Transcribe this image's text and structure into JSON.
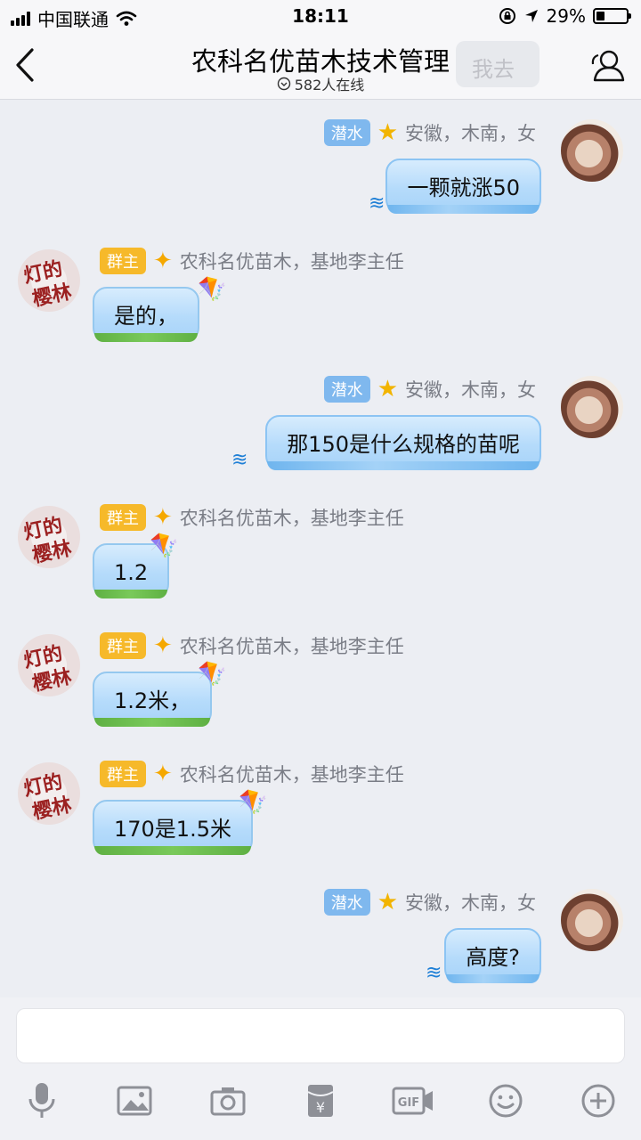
{
  "status": {
    "carrier": "中国联通",
    "time": "18:11",
    "battery": "29%",
    "battery_level": 0.29
  },
  "header": {
    "title": "农科名优苗木技术管理",
    "online": "582人在线",
    "ghost_text": "我去"
  },
  "messages": [
    {
      "side": "right",
      "badge": "潜水",
      "meta": "安徽，木南，女",
      "text": "一颗就涨50"
    },
    {
      "side": "left",
      "badge": "群主",
      "meta": "农科名优苗木，基地李主任",
      "text": "是的，"
    },
    {
      "side": "right",
      "badge": "潜水",
      "meta": "安徽，木南，女",
      "text": "那150是什么规格的苗呢"
    },
    {
      "side": "left",
      "badge": "群主",
      "meta": "农科名优苗木，基地李主任",
      "text": "1.2"
    },
    {
      "side": "left",
      "badge": "群主",
      "meta": "农科名优苗木，基地李主任",
      "text": "1.2米，"
    },
    {
      "side": "left",
      "badge": "群主",
      "meta": "农科名优苗木，基地李主任",
      "text": "170是1.5米"
    },
    {
      "side": "right",
      "badge": "潜水",
      "meta": "安徽，木南，女",
      "text": "高度?"
    }
  ],
  "toolbar": {
    "items": [
      "mic-icon",
      "image-icon",
      "camera-icon",
      "red-packet-icon",
      "gif-icon",
      "emoji-icon",
      "plus-icon"
    ],
    "gif_label": "GIF",
    "yuan_label": "¥"
  },
  "colors": {
    "background": "#eceef3",
    "bubble_blue": "#b5dbfb",
    "badge_dive": "#7fb8ee",
    "badge_owner": "#f6b92a"
  }
}
